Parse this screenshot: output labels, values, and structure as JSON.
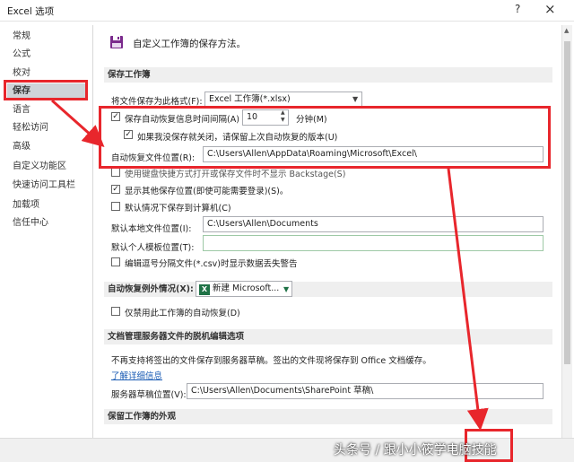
{
  "window": {
    "title": "Excel 选项",
    "help_icon": "?",
    "close_icon": "×"
  },
  "sidebar": {
    "items": [
      {
        "label": "常规"
      },
      {
        "label": "公式"
      },
      {
        "label": "校对"
      },
      {
        "label": "保存",
        "selected": true
      },
      {
        "label": "语言"
      },
      {
        "label": "轻松访问"
      },
      {
        "label": "高级"
      },
      {
        "label": "自定义功能区"
      },
      {
        "label": "快速访问工具栏"
      },
      {
        "label": "加载项"
      },
      {
        "label": "信任中心"
      }
    ]
  },
  "main": {
    "header": "自定义工作簿的保存方法。",
    "sections": {
      "save": "保存工作簿",
      "autorecover_exceptions": "自动恢复例外情况(X):",
      "offline": "文档管理服务器文件的脱机编辑选项",
      "appearance": "保留工作簿的外观"
    },
    "save_format": {
      "label": "将文件保存为此格式(F):",
      "value": "Excel 工作簿(*.xlsx)"
    },
    "autorecover": {
      "label": "保存自动恢复信息时间间隔(A)",
      "minutes": "10",
      "unit": "分钟(M)",
      "checked": true
    },
    "keep_last": {
      "label": "如果我没保存就关闭，请保留上次自动恢复的版本(U)",
      "checked": true
    },
    "autorecover_location": {
      "label": "自动恢复文件位置(R):",
      "value": "C:\\Users\\Allen\\AppData\\Roaming\\Microsoft\\Excel\\"
    },
    "backstage": {
      "label": "使用键盘快捷方式打开或保存文件时不显示 Backstage(S)",
      "checked": false
    },
    "show_additional": {
      "label": "显示其他保存位置(即使可能需要登录)(S)。",
      "checked": true
    },
    "default_computer": {
      "label": "默认情况下保存到计算机(C)",
      "checked": false
    },
    "local_location": {
      "label": "默认本地文件位置(I):",
      "value": "C:\\Users\\Allen\\Documents"
    },
    "personal_templates": {
      "label": "默认个人模板位置(T):",
      "value": ""
    },
    "csv_warning": {
      "label": "编辑逗号分隔文件(*.csv)时显示数据丢失警告",
      "checked": false
    },
    "exception_workbook": {
      "value": "新建 Microsoft..."
    },
    "disable_autorecover": {
      "label": "仅禁用此工作簿的自动恢复(D)",
      "checked": false
    },
    "offline_note": "不再支持将签出的文件保存到服务器草稿。签出的文件现将保存到 Office 文档缓存。",
    "learn_more": "了解详细信息",
    "drafts_location": {
      "label": "服务器草稿位置(V):",
      "value": "C:\\Users\\Allen\\Documents\\SharePoint 草稿\\"
    }
  },
  "watermark": "头条号 / 跟小小筱学电脑技能",
  "colors": {
    "highlight_red": "#e8262c",
    "selected_bg": "#cfd3d8",
    "link": "#1a5bb4"
  }
}
